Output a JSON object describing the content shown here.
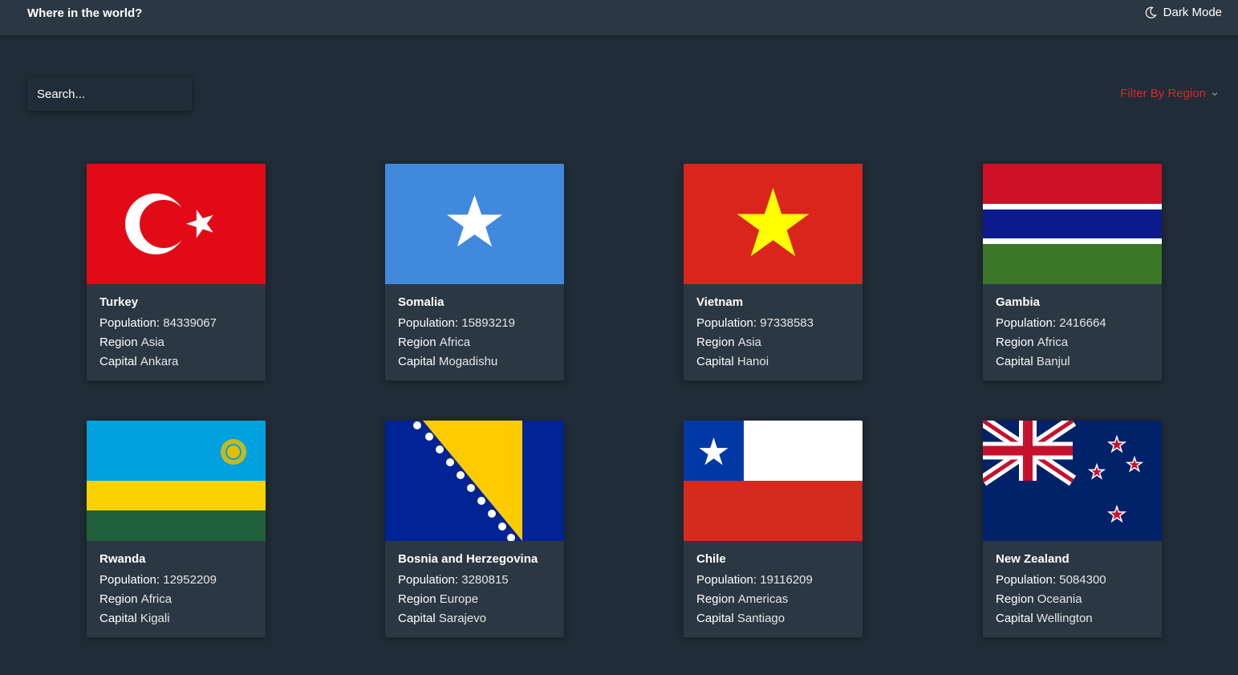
{
  "header": {
    "title": "Where in the world?",
    "mode_label": "Dark Mode",
    "mode_icon": "moon-icon"
  },
  "search": {
    "placeholder": "Search..."
  },
  "filter": {
    "label": "Filter By Region",
    "icon": "chevron-down-icon"
  },
  "colors": {
    "background": "#202c37",
    "card": "#2b3743",
    "accent": "#e0242a"
  },
  "labels": {
    "population": "Population:",
    "region": "Region",
    "capital": "Capital"
  },
  "countries": [
    {
      "name": "Turkey",
      "population": "84339067",
      "region": "Asia",
      "capital": "Ankara",
      "flag": "turkey-flag"
    },
    {
      "name": "Somalia",
      "population": "15893219",
      "region": "Africa",
      "capital": "Mogadishu",
      "flag": "somalia-flag"
    },
    {
      "name": "Vietnam",
      "population": "97338583",
      "region": "Asia",
      "capital": "Hanoi",
      "flag": "vietnam-flag"
    },
    {
      "name": "Gambia",
      "population": "2416664",
      "region": "Africa",
      "capital": "Banjul",
      "flag": "gambia-flag"
    },
    {
      "name": "Rwanda",
      "population": "12952209",
      "region": "Africa",
      "capital": "Kigali",
      "flag": "rwanda-flag"
    },
    {
      "name": "Bosnia and Herzegovina",
      "population": "3280815",
      "region": "Europe",
      "capital": "Sarajevo",
      "flag": "bosnia-flag"
    },
    {
      "name": "Chile",
      "population": "19116209",
      "region": "Americas",
      "capital": "Santiago",
      "flag": "chile-flag"
    },
    {
      "name": "New Zealand",
      "population": "5084300",
      "region": "Oceania",
      "capital": "Wellington",
      "flag": "new-zealand-flag"
    }
  ]
}
